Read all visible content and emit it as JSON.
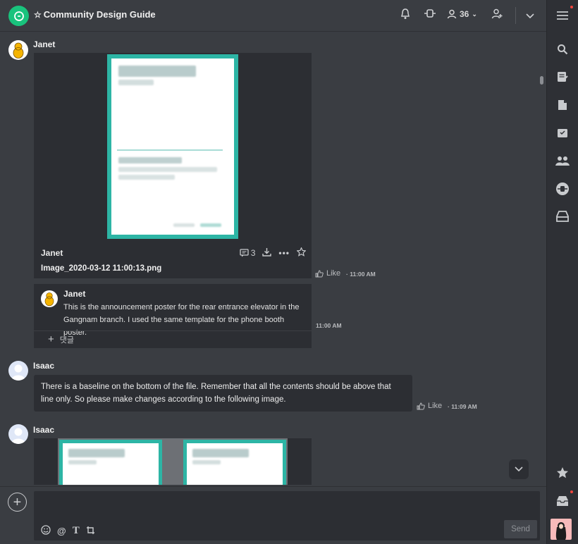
{
  "header": {
    "title": "Community Design Guide",
    "member_count": "36"
  },
  "messages": [
    {
      "sender": "Janet",
      "file": {
        "owner": "Janet",
        "name": "Image_2020-03-12 11:00:13.png",
        "comment_count": "3"
      },
      "like_label": "Like",
      "time": "11:00 AM"
    },
    {
      "comment": {
        "sender": "Janet",
        "text": "This is the announcement poster for the rear entrance elevator in the Gangnam branch.  I used the same template for the phone booth poster."
      },
      "time": "11:00 AM",
      "add_comment_label": "댓글"
    },
    {
      "sender": "Isaac",
      "text": "There is a baseline on the bottom of the file.  Remember that all the contents should be above that line only.  So please make changes according to the following image.",
      "like_label": "Like",
      "time": "11:09 AM"
    },
    {
      "sender": "Isaac"
    }
  ],
  "composer": {
    "placeholder": "",
    "send_label": "Send"
  },
  "colors": {
    "accent_green": "#19c37d",
    "poster_teal": "#2db5a5",
    "notification_red": "#f1453d"
  }
}
